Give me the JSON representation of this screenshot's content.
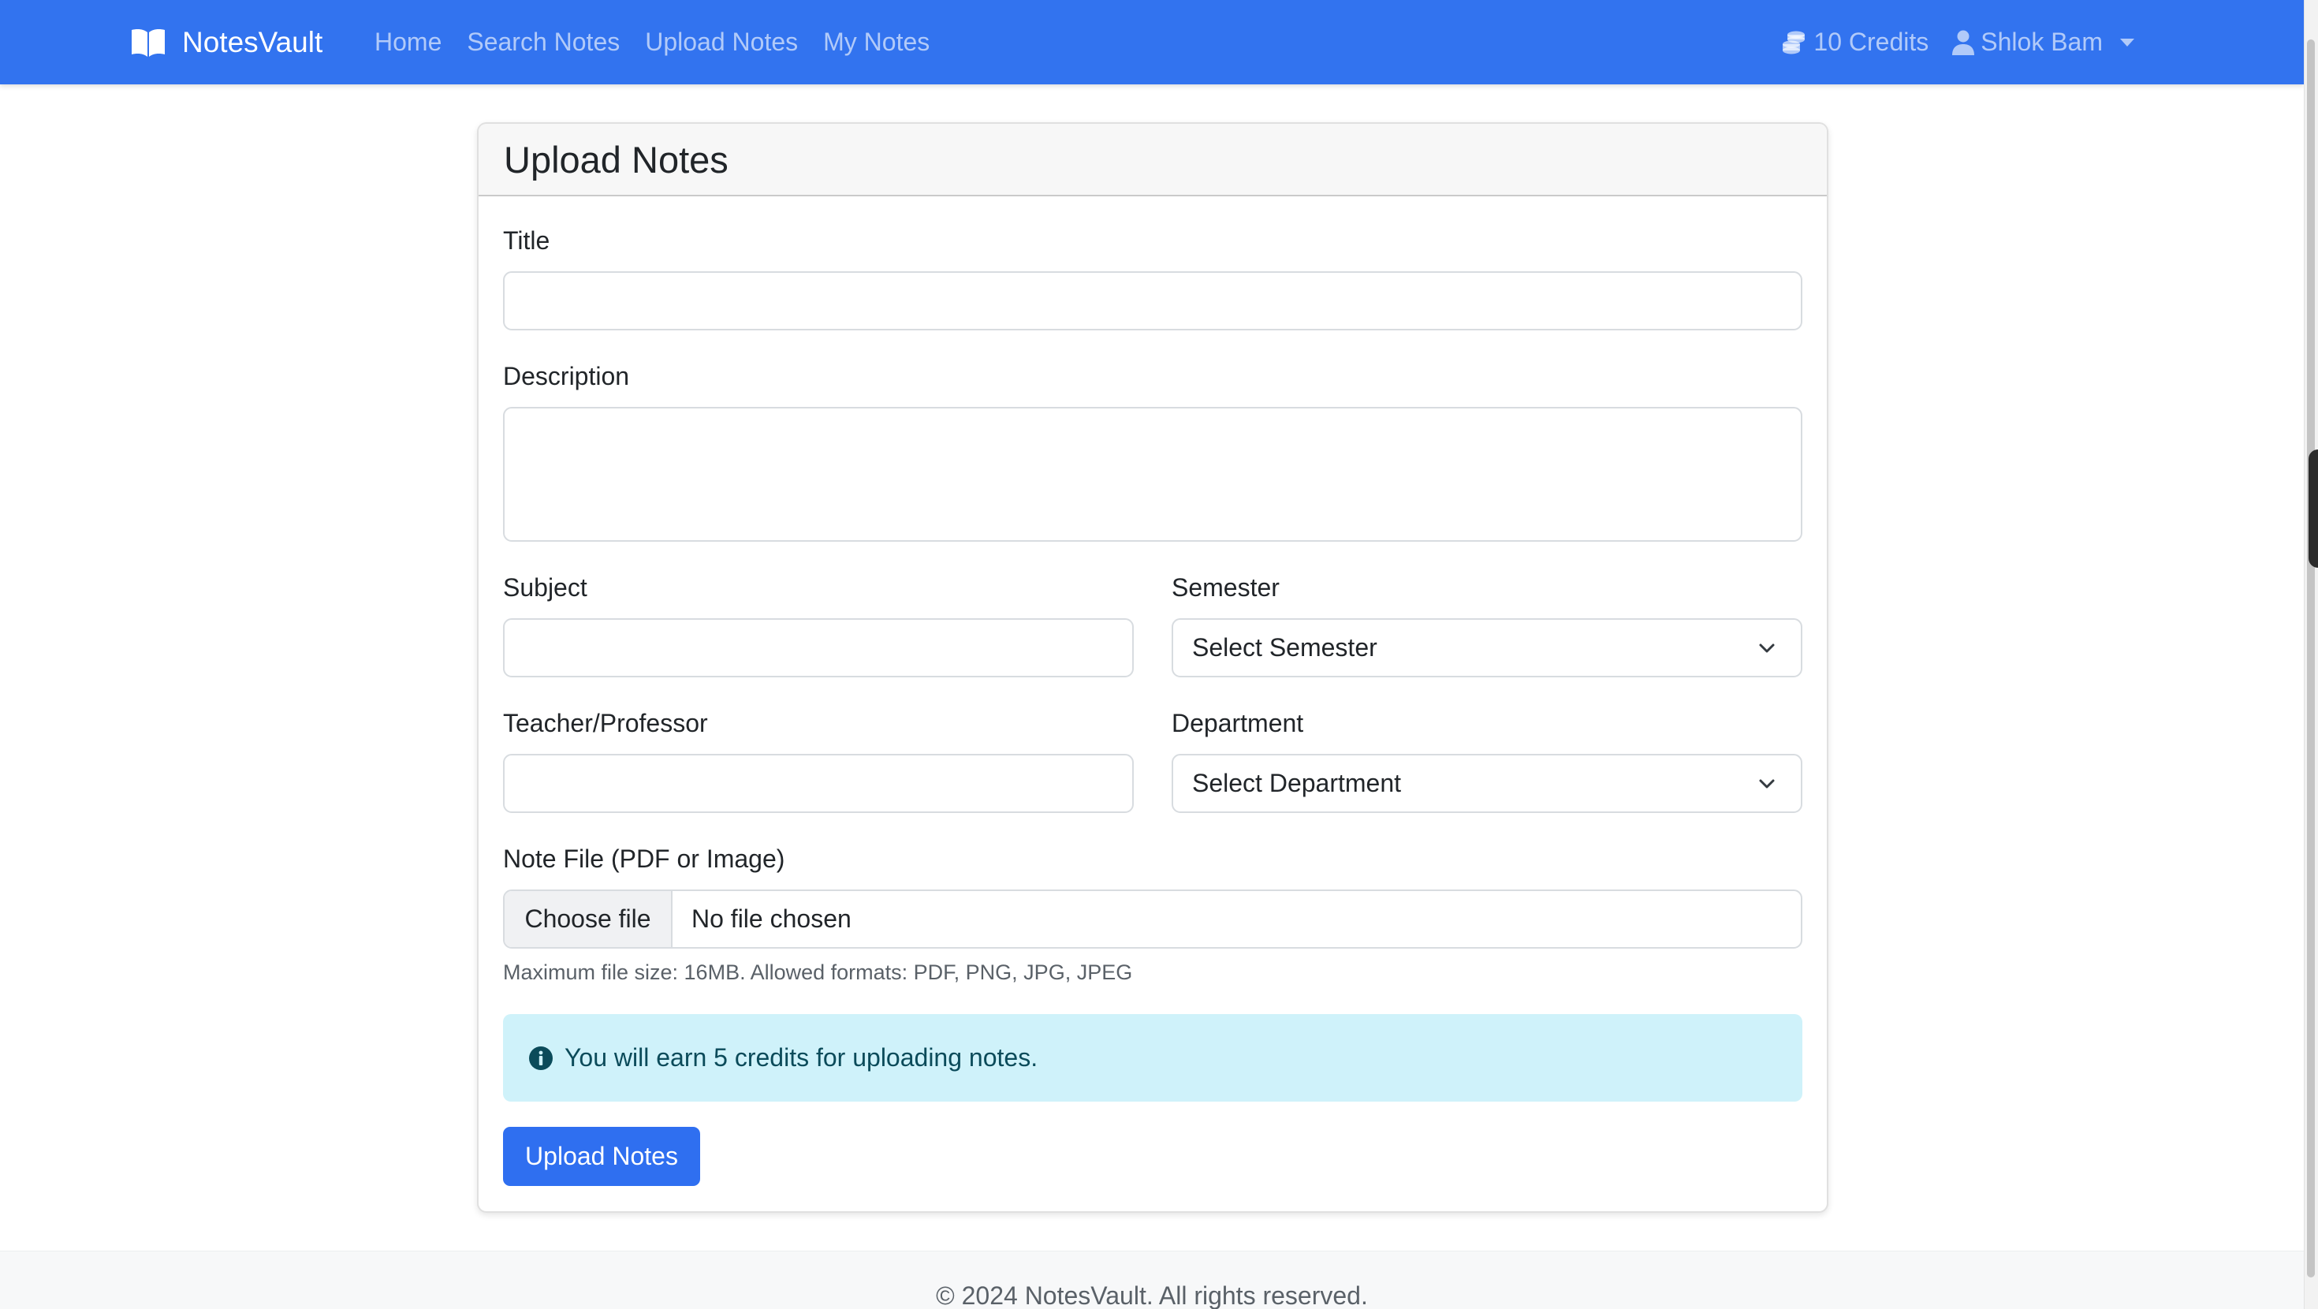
{
  "navbar": {
    "brand": "NotesVault",
    "links": [
      "Home",
      "Search Notes",
      "Upload Notes",
      "My Notes"
    ],
    "credits": "10 Credits",
    "user": "Shlok Bam"
  },
  "form": {
    "heading": "Upload Notes",
    "title_label": "Title",
    "title_value": "",
    "description_label": "Description",
    "description_value": "",
    "subject_label": "Subject",
    "subject_value": "",
    "semester_label": "Semester",
    "semester_selected": "Select Semester",
    "teacher_label": "Teacher/Professor",
    "teacher_value": "",
    "department_label": "Department",
    "department_selected": "Select Department",
    "file_label": "Note File (PDF or Image)",
    "file_button": "Choose file",
    "file_status": "No file chosen",
    "file_help": "Maximum file size: 16MB. Allowed formats: PDF, PNG, JPG, JPEG",
    "info_message": "You will earn 5 credits for uploading notes.",
    "submit_label": "Upload Notes"
  },
  "footer": {
    "text": "© 2024 NotesVault. All rights reserved."
  },
  "colors": {
    "navbar": "#3273ef",
    "primary_button": "#2f6ff0",
    "info_alert": "#cff2fa"
  }
}
